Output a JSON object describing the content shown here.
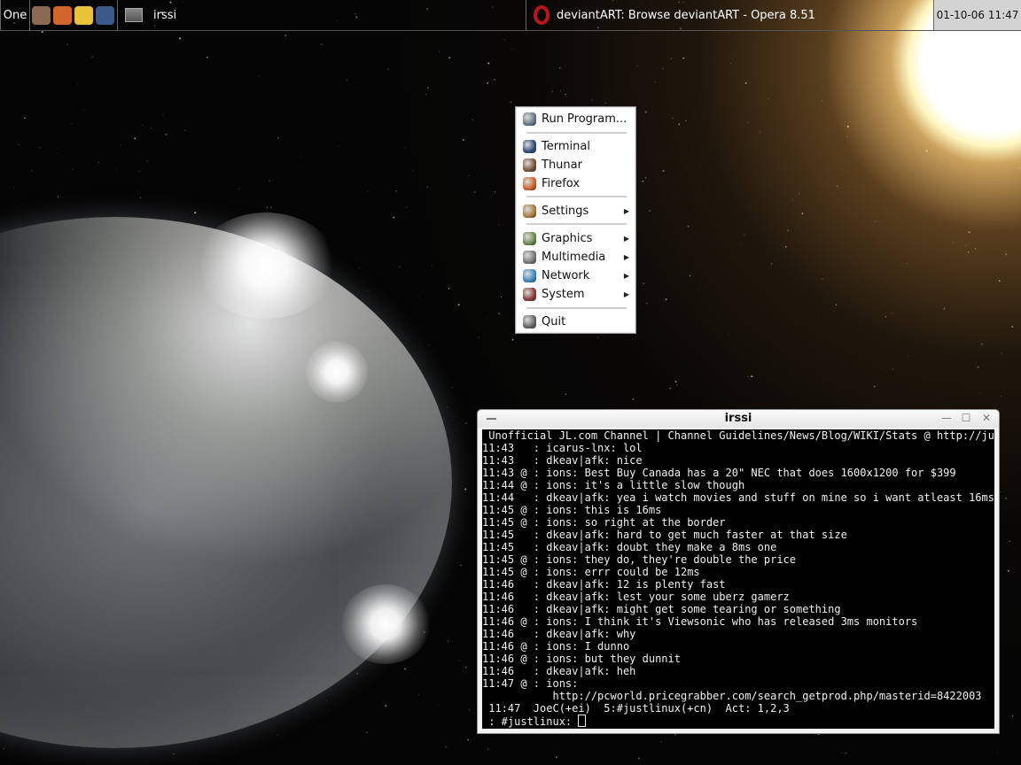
{
  "panel": {
    "workspace": "One",
    "launchers": [
      {
        "name": "thunar-icon",
        "color": "#8a6a50"
      },
      {
        "name": "firefox-icon",
        "color": "#d2652a"
      },
      {
        "name": "chat-bubble-icon",
        "color": "#e8c23a"
      },
      {
        "name": "terminal-icon",
        "color": "#3a5a8a"
      }
    ],
    "tasks": [
      {
        "label": "irssi",
        "icon": "window-icon"
      },
      {
        "label": "deviantART: Browse deviantART - Opera 8.51",
        "icon": "opera-icon"
      }
    ],
    "clock": "01-10-06 11:47"
  },
  "menu": {
    "items": [
      {
        "label": "Run Program...",
        "icon": "run-program-icon",
        "color": "#667788",
        "submenu": false
      },
      {
        "label": "Terminal",
        "icon": "terminal-icon",
        "color": "#2d4d7a",
        "submenu": false
      },
      {
        "label": "Thunar",
        "icon": "thunar-icon",
        "color": "#7a5036",
        "submenu": false
      },
      {
        "label": "Firefox",
        "icon": "firefox-icon",
        "color": "#d0622a",
        "submenu": false
      },
      {
        "label": "Settings",
        "icon": "settings-icon",
        "color": "#b07a3a",
        "submenu": true
      },
      {
        "label": "Graphics",
        "icon": "graphics-icon",
        "color": "#6a8a4a",
        "submenu": true
      },
      {
        "label": "Multimedia",
        "icon": "multimedia-icon",
        "color": "#777777",
        "submenu": true
      },
      {
        "label": "Network",
        "icon": "network-icon",
        "color": "#3a8ac0",
        "submenu": true
      },
      {
        "label": "System",
        "icon": "system-icon",
        "color": "#8a3a3a",
        "submenu": true
      },
      {
        "label": "Quit",
        "icon": "quit-icon",
        "color": "#666666",
        "submenu": false
      }
    ],
    "submenu_arrow": "▶"
  },
  "terminal": {
    "title": "irssi",
    "topic": " Unofficial JL.com Channel | Channel Guidelines/News/Blog/WIKI/Stats @ http://ju",
    "lines": [
      "11:43   : icarus-lnx: lol",
      "11:43   : dkeav|afk: nice",
      "11:43 @ : ions: Best Buy Canada has a 20\" NEC that does 1600x1200 for $399",
      "11:44 @ : ions: it's a little slow though",
      "11:44   : dkeav|afk: yea i watch movies and stuff on mine so i want atleast 16ms",
      "11:45 @ : ions: this is 16ms",
      "11:45 @ : ions: so right at the border",
      "11:45   : dkeav|afk: hard to get much faster at that size",
      "11:45   : dkeav|afk: doubt they make a 8ms one",
      "11:45 @ : ions: they do, they're double the price",
      "11:45 @ : ions: errr could be 12ms",
      "11:46   : dkeav|afk: 12 is plenty fast",
      "11:46   : dkeav|afk: lest your some uberz gamerz",
      "11:46   : dkeav|afk: might get some tearing or something",
      "11:46 @ : ions: I think it's Viewsonic who has released 3ms monitors",
      "11:46   : dkeav|afk: why",
      "11:46 @ : ions: I dunno",
      "11:46 @ : ions: but they dunnit",
      "11:46   : dkeav|afk: heh",
      "11:47 @ : ions:",
      "           http://pcworld.pricegrabber.com/search_getprod.php/masterid=8422003"
    ],
    "statusbar": " 11:47  JoeC(+ei)  5:#justlinux(+cn)  Act: 1,2,3",
    "prompt": " : #justlinux: ",
    "buttons": {
      "minimize": "—",
      "maximize": "☐",
      "close": "✕"
    }
  }
}
